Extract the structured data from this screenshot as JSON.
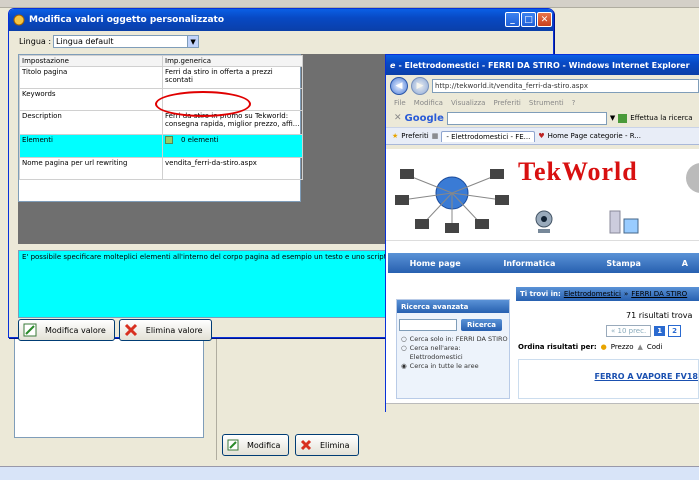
{
  "dialog": {
    "title": "Modifica valori oggetto personalizzato",
    "language_label": "Lingua :",
    "language_value": "Lingua default",
    "grid": {
      "headers": [
        "Impostazione",
        "Imp.generica"
      ],
      "rows": [
        {
          "setting": "Titolo pagina",
          "value": "Ferri da stiro in offerta a prezzi scontati"
        },
        {
          "setting": "Keywords",
          "value": ""
        },
        {
          "setting": "Description",
          "value": "Ferri da stiro in promo su Tekworld: consegna rapida, miglior prezzo, affi..."
        },
        {
          "setting": "Elementi",
          "value": "0 elementi"
        },
        {
          "setting": "Nome pagina per url rewriting",
          "value": "vendita_ferri-da-stiro.aspx"
        }
      ]
    },
    "description_text": "E' possibile specificare molteplici elementi all'interno del corpo pagina ad esempio un testo e uno script.",
    "edit_button": "Modifica valore",
    "delete_button": "Elimina valore"
  },
  "background_app": {
    "edit_button": "Modifica",
    "delete_button": "Elimina"
  },
  "browser": {
    "title": "- Elettrodomestici - FERRI DA STIRO - Windows Internet Explorer",
    "url": "http://tekworld.it/vendita_ferri-da-stiro.aspx",
    "menu": [
      "File",
      "Modifica",
      "Visualizza",
      "Preferiti",
      "Strumenti",
      "?"
    ],
    "google_label": "Google",
    "google_action": "Effettua la ricerca",
    "favorites_label": "Preferiti",
    "tabs": [
      "- Elettrodomestici - FE...",
      "Home Page categorie - R..."
    ],
    "site": {
      "logo_text": "TekWorld",
      "nav": [
        "Home page",
        "Informatica",
        "Stampa",
        "A"
      ],
      "search_panel_title": "Ricerca avanzata",
      "search_button": "Ricerca",
      "radio_options": [
        "Cerca solo in: FERRI DA STIRO",
        "Cerca nell'area: Elettrodomestici",
        "Cerca in tutte le aree"
      ],
      "breadcrumb_prefix": "Ti trovi in:",
      "breadcrumb_1": "Elettrodomestici",
      "breadcrumb_sep": "»",
      "breadcrumb_2": "FERRI DA STIRO",
      "results": "71 risultati trova",
      "prev": "« 10 prec.",
      "pages": [
        "1",
        "2"
      ],
      "sort_label": "Ordina risultati per:",
      "sort_price": "Prezzo",
      "sort_code": "Codi",
      "product_title": "FERRO A VAPORE FV18"
    }
  }
}
